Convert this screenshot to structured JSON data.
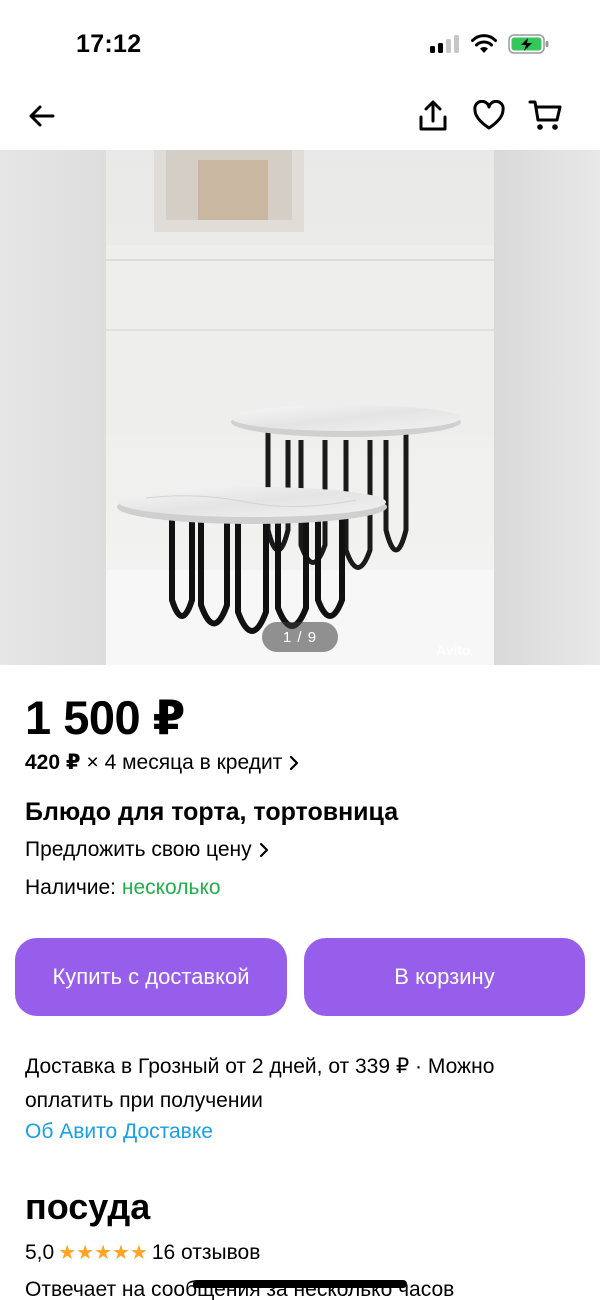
{
  "status_bar": {
    "time": "17:12",
    "icons": [
      "signal-icon",
      "wifi-icon",
      "battery-charging-icon"
    ]
  },
  "nav": {
    "icons": [
      "back-arrow-icon",
      "share-icon",
      "heart-icon",
      "cart-icon"
    ]
  },
  "gallery": {
    "counter": "1 / 9",
    "watermark": "Avito"
  },
  "listing": {
    "price": "1 500 ₽",
    "credit_amount": "420 ₽",
    "credit_rest": "× 4 месяца в кредит",
    "title": "Блюдо для торта, тортовница",
    "offer_price": "Предложить свою цену",
    "availability_label": "Наличие:",
    "availability_value": "несколько"
  },
  "buttons": {
    "buy_with_delivery": "Купить с доставкой",
    "add_to_cart": "В корзину"
  },
  "delivery": {
    "text": "Доставка в Грозный от 2 дней, от 339 ₽ · Можно оплатить при получении",
    "link": "Об Авито Доставке"
  },
  "seller": {
    "name": "посуда",
    "rating": "5,0",
    "stars": "★★★★★",
    "reviews": "16 отзывов",
    "response": "Отвечает на сообщения за несколько часов"
  },
  "colors": {
    "accent": "#965eeb",
    "link": "#1aa0e6",
    "availability": "#22b04a",
    "star": "#ffa425"
  }
}
